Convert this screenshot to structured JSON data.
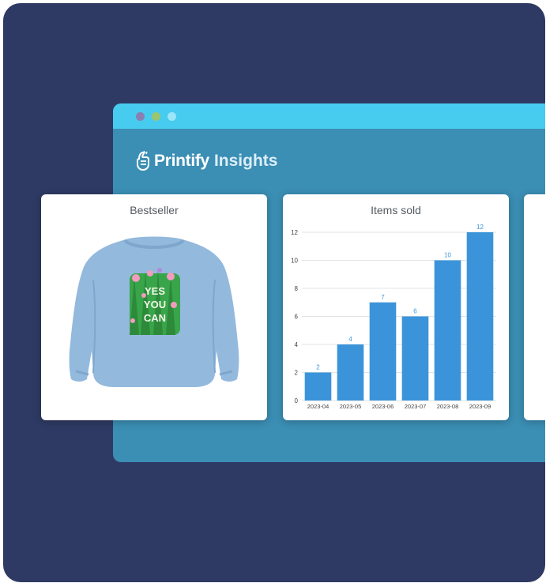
{
  "app": {
    "brand_name": "Printify",
    "brand_suffix": "Insights",
    "accent_color": "#47cbef",
    "background_color": "#2e3a63",
    "panel_color": "#3b8eb4",
    "icons": [
      "printify-logo-icon",
      "window-dot-icon"
    ]
  },
  "bestseller": {
    "title": "Bestseller",
    "product_print_text": [
      "YES",
      "YOU",
      "CAN"
    ],
    "product_color": "#93b9dd"
  },
  "items_sold": {
    "title": "Items sold"
  },
  "chart_data": {
    "type": "bar",
    "title": "Items sold",
    "categories": [
      "2023-04",
      "2023-05",
      "2023-06",
      "2023-07",
      "2023-08",
      "2023-09"
    ],
    "values": [
      2,
      4,
      7,
      6,
      10,
      12
    ],
    "yticks": [
      0,
      2,
      4,
      6,
      8,
      10,
      12
    ],
    "ylim": [
      0,
      12
    ],
    "xlabel": "",
    "ylabel": "",
    "grid": true,
    "data_labels": true,
    "bar_color": "#3b94d9",
    "label_color": "#3b94d9"
  }
}
